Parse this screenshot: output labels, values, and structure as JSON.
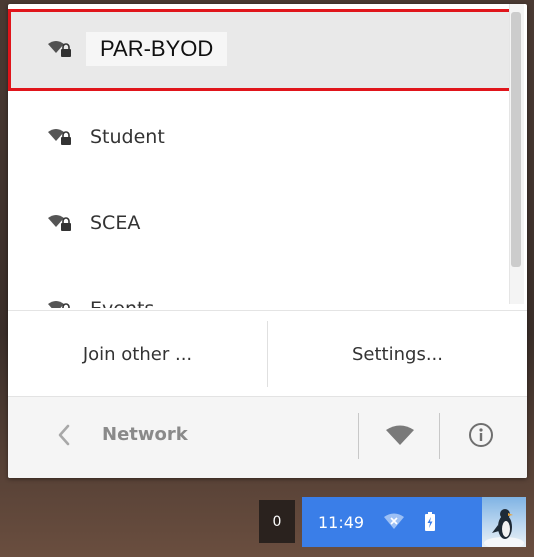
{
  "networks": [
    {
      "name": "PAR-BYOD",
      "secured": true,
      "selected": true
    },
    {
      "name": "Student",
      "secured": true,
      "selected": false
    },
    {
      "name": "SCEA",
      "secured": true,
      "selected": false
    },
    {
      "name": "Events",
      "secured": true,
      "selected": false
    }
  ],
  "actions": {
    "join_other": "Join other ...",
    "settings": "Settings..."
  },
  "footer": {
    "title": "Network",
    "back_icon": "chevron-left-icon",
    "wifi_icon": "wifi-icon",
    "info_icon": "info-icon"
  },
  "shelf": {
    "badge_count": "0",
    "clock": "11:49",
    "wifi_icon": "wifi-no-signal-icon",
    "battery_icon": "battery-charging-icon"
  },
  "colors": {
    "highlight": "#e0151b",
    "status_area": "#3a7ee8",
    "text": "#333333",
    "muted": "#8a8a8a"
  }
}
